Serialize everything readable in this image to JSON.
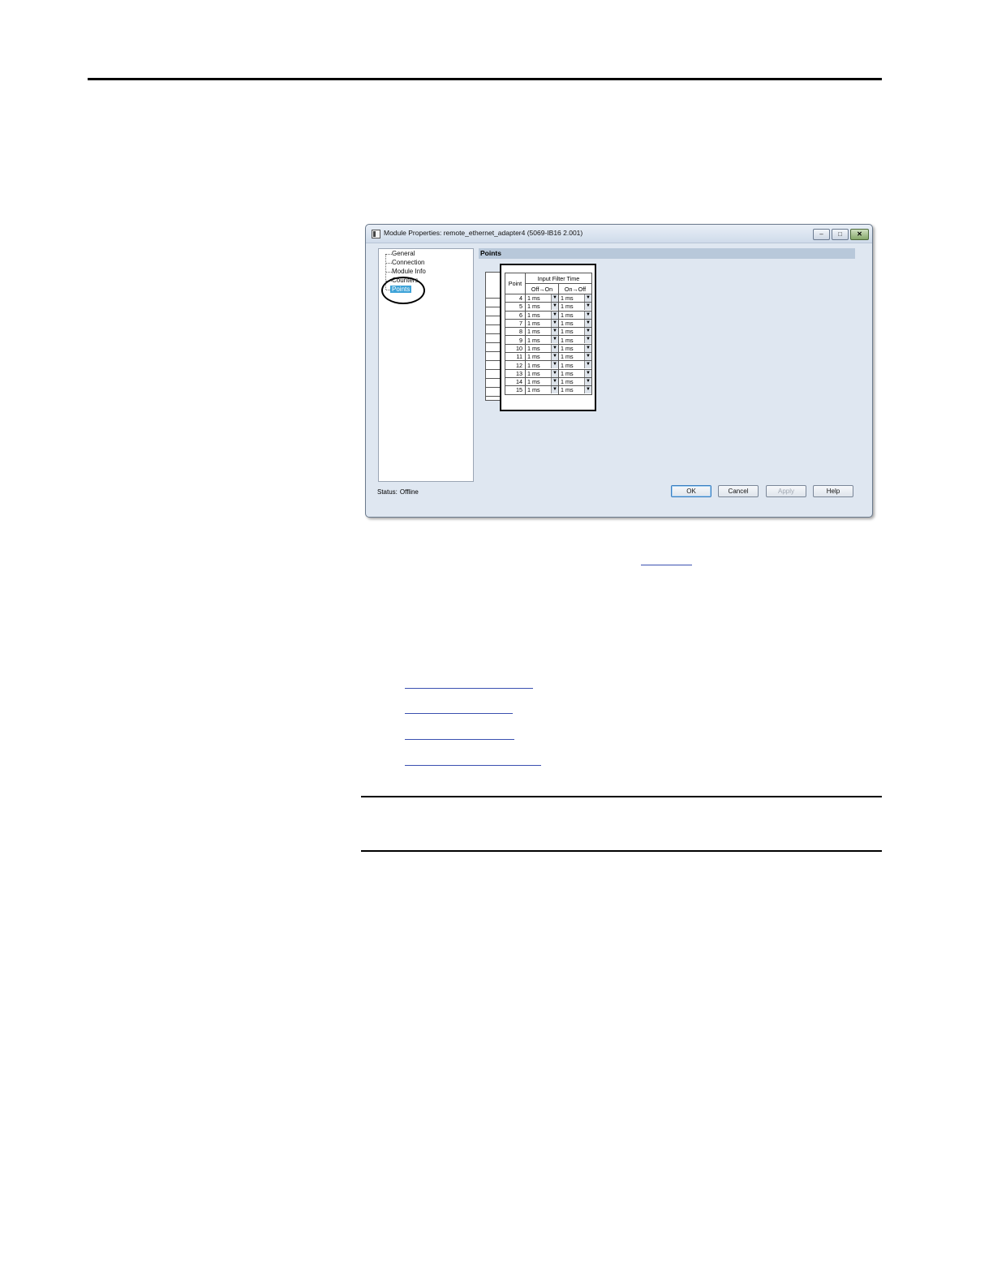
{
  "dialog": {
    "title": "Module Properties: remote_ethernet_adapter4 (5069-IB16 2.001)",
    "window_buttons": {
      "minimize": "–",
      "maximize": "□",
      "close": "✕"
    },
    "tree": {
      "items": [
        "General",
        "Connection",
        "Module Info",
        "Counters",
        "Points"
      ],
      "selected": "Points"
    },
    "section_title": "Points",
    "table": {
      "group_header": "Input Filter Time",
      "point_header": "Point",
      "col_off_on": "Off→On",
      "col_on_off": "On→Off",
      "rows": [
        {
          "point": "4",
          "off_on": "1 ms",
          "on_off": "1 ms"
        },
        {
          "point": "5",
          "off_on": "1 ms",
          "on_off": "1 ms"
        },
        {
          "point": "6",
          "off_on": "1 ms",
          "on_off": "1 ms"
        },
        {
          "point": "7",
          "off_on": "1 ms",
          "on_off": "1 ms"
        },
        {
          "point": "8",
          "off_on": "1 ms",
          "on_off": "1 ms"
        },
        {
          "point": "9",
          "off_on": "1 ms",
          "on_off": "1 ms"
        },
        {
          "point": "10",
          "off_on": "1 ms",
          "on_off": "1 ms"
        },
        {
          "point": "11",
          "off_on": "1 ms",
          "on_off": "1 ms"
        },
        {
          "point": "12",
          "off_on": "1 ms",
          "on_off": "1 ms"
        },
        {
          "point": "13",
          "off_on": "1 ms",
          "on_off": "1 ms"
        },
        {
          "point": "14",
          "off_on": "1 ms",
          "on_off": "1 ms"
        },
        {
          "point": "15",
          "off_on": "1 ms",
          "on_off": "1 ms"
        }
      ]
    },
    "status_label": "Status:",
    "status_value": "Offline",
    "buttons": {
      "ok": "OK",
      "cancel": "Cancel",
      "apply": "Apply",
      "help": "Help"
    },
    "colors": {
      "selection": "#3ea3d8",
      "dialog_bg": "#dfe7f1",
      "header_bg": "#b8c8da"
    }
  }
}
